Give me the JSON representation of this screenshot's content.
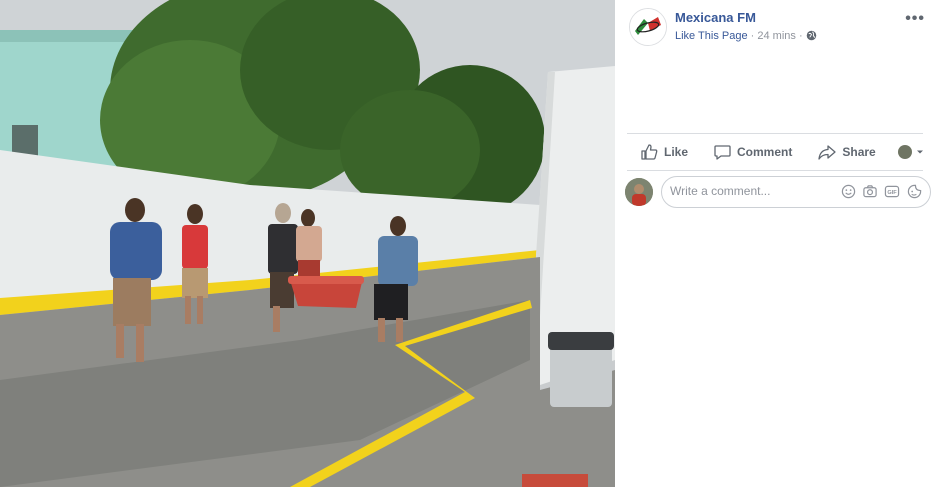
{
  "post": {
    "page_name": "Mexicana FM",
    "like_link": "Like This Page",
    "separator": " · ",
    "time": "24 mins",
    "separator2": " · ",
    "more_label": "•••",
    "privacy_icon": "globe-icon"
  },
  "actions": {
    "like": "Like",
    "comment": "Comment",
    "share": "Share"
  },
  "comment": {
    "placeholder": "Write a comment..."
  },
  "colors": {
    "link": "#385898",
    "muted": "#90949c",
    "action": "#606770",
    "curb_yellow": "#f2d21c"
  }
}
